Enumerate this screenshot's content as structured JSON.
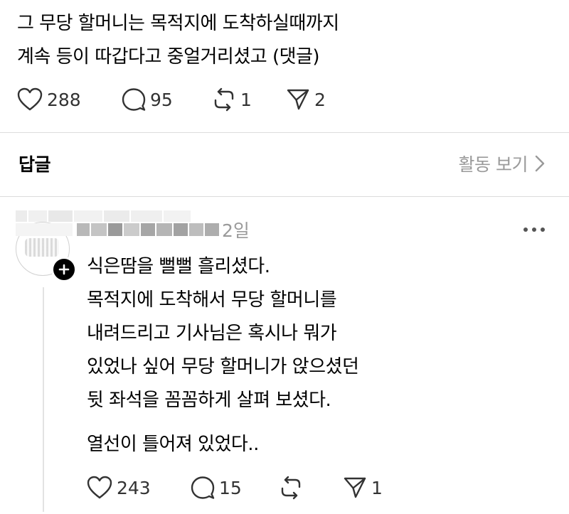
{
  "post": {
    "lines": [
      "그 무당 할머니는 목적지에 도착하실때까지",
      "계속 등이 따갑다고 중얼거리셨고 (댓글)"
    ],
    "actions": {
      "likes": "288",
      "replies": "95",
      "reposts": "1",
      "shares": "2"
    }
  },
  "replies_section": {
    "heading": "답글",
    "activity_link": "활동 보기"
  },
  "reply": {
    "time": "2일",
    "lines": [
      "식은땀을 뻘뻘 흘리셨다.",
      "목적지에 도착해서 무당 할머니를",
      "내려드리고 기사님은 혹시나 뭐가",
      "있었나 싶어 무당 할머니가 앉으셨던",
      "뒷 좌석을 꼼꼼하게 살펴 보셨다."
    ],
    "last_line": "열선이 틀어져 있었다..",
    "actions": {
      "likes": "243",
      "replies": "15",
      "shares": "1"
    }
  },
  "icons": {
    "like": "heart-icon",
    "reply": "speech-bubble-icon",
    "repost": "repost-icon",
    "share": "paper-plane-icon",
    "more": "more-dots-icon",
    "chevron": "chevron-right-icon",
    "follow": "plus-icon"
  },
  "colors": {
    "text": "#000000",
    "muted": "#9a9a9a",
    "divider": "#dcdcdc",
    "badge": "#000000"
  }
}
